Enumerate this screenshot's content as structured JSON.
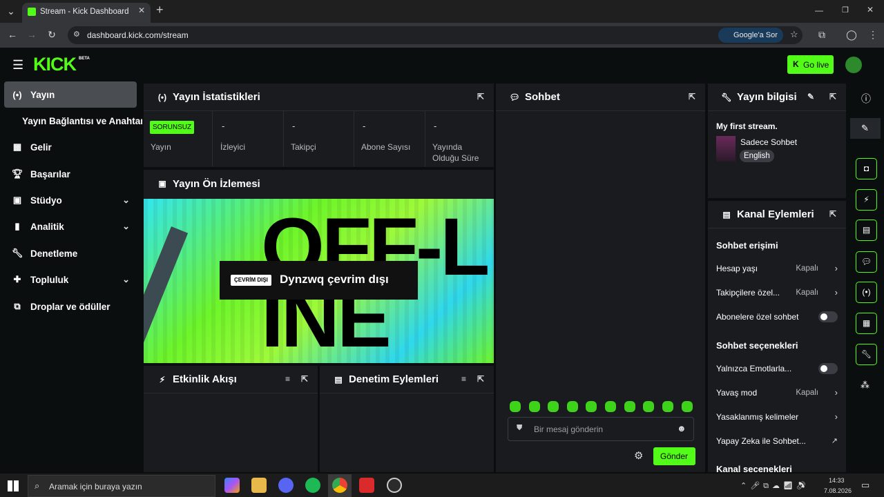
{
  "browser": {
    "tab_title": "Stream - Kick Dashboard",
    "url": "dashboard.kick.com/stream",
    "google_btn": "Google'a Sor"
  },
  "header": {
    "logo": "KICK",
    "beta": "BETA",
    "go_live": "Go live"
  },
  "sidebar": {
    "items": [
      {
        "label": "Yayın"
      },
      {
        "label": "Yayın Bağlantısı ve Anahtarı"
      },
      {
        "label": "Gelir"
      },
      {
        "label": "Başarılar"
      },
      {
        "label": "Stüdyo"
      },
      {
        "label": "Analitik"
      },
      {
        "label": "Denetleme"
      },
      {
        "label": "Topluluk"
      },
      {
        "label": "Droplar ve ödüller"
      }
    ]
  },
  "stats": {
    "title": "Yayın İstatistikleri",
    "badge": "SORUNSUZ",
    "cols": [
      {
        "value": "",
        "label": "Yayın"
      },
      {
        "value": "-",
        "label": "İzleyici"
      },
      {
        "value": "-",
        "label": "Takipçi"
      },
      {
        "value": "-",
        "label": "Abone Sayısı"
      },
      {
        "value": "-",
        "label": "Yayında Olduğu Süre"
      }
    ]
  },
  "preview": {
    "title": "Yayın Ön İzlemesi",
    "offline_badge": "ÇEVRİM DIŞI",
    "offline_text": "Dynzwq çevrim dışı",
    "bg_text": "OFF-LINE"
  },
  "activity": {
    "title": "Etkinlik Akışı"
  },
  "modactions": {
    "title": "Denetim Eylemleri"
  },
  "chat": {
    "title": "Sohbet",
    "placeholder": "Bir mesaj gönderin",
    "send": "Gönder"
  },
  "streaminfo": {
    "title": "Yayın bilgisi",
    "stream_title": "My first stream.",
    "category": "Sadece Sohbet",
    "language": "English"
  },
  "channel": {
    "title": "Kanal Eylemleri",
    "chat_access": "Sohbet erişimi",
    "account_age": {
      "label": "Hesap yaşı",
      "value": "Kapalı"
    },
    "followers_only": {
      "label": "Takipçilere özel...",
      "value": "Kapalı"
    },
    "subs_only": {
      "label": "Abonelere özel sohbet"
    },
    "chat_options": "Sohbet seçenekleri",
    "emote_only": {
      "label": "Yalnızca Emotlarla..."
    },
    "slow_mode": {
      "label": "Yavaş mod",
      "value": "Kapalı"
    },
    "banned_words": {
      "label": "Yasaklanmış kelimeler"
    },
    "ai_chat": {
      "label": "Yapay Zeka ile Sohbet..."
    },
    "cut_off": "Kanal seçenekleri"
  },
  "taskbar": {
    "search": "Aramak için buraya yazın",
    "time": "14:33",
    "date": "7.08.2026"
  },
  "colors": {
    "accent": "#53fc18",
    "panel": "#191b1f",
    "bg": "#0b0e0f"
  }
}
